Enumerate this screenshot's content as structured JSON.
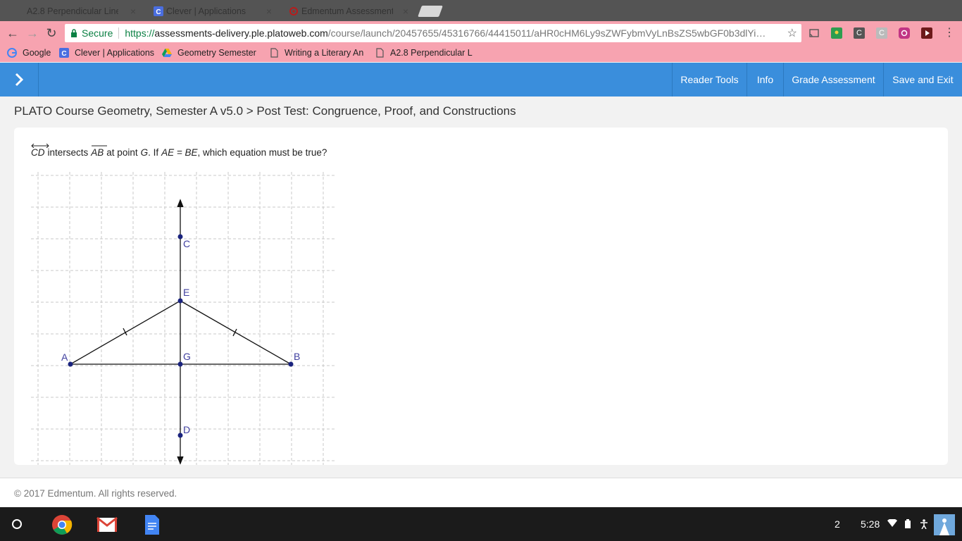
{
  "browser": {
    "tabs": [
      {
        "title": "A2.8 Perpendicular Line",
        "icon": "document-icon",
        "active": false
      },
      {
        "title": "Clever | Applications",
        "icon": "clever-icon",
        "active": false
      },
      {
        "title": "Edmentum Assessment",
        "icon": "edmentum-icon",
        "active": true
      }
    ],
    "close_glyph": "×",
    "security_label": "Secure",
    "url": {
      "scheme": "https://",
      "domain": "assessments-delivery.ple.platoweb.com",
      "path": "/course/launch/20457655/45316766/44415011/aHR0cHM6Ly9sZWFybmVyLnBsZS5wbGF0b3dlYi…"
    },
    "bookmarks": [
      {
        "label": "Google",
        "icon": "google-icon"
      },
      {
        "label": "Clever | Applications",
        "icon": "clever-icon"
      },
      {
        "label": "Geometry Semester",
        "icon": "drive-icon"
      },
      {
        "label": "Writing a Literary An",
        "icon": "document-icon"
      },
      {
        "label": "A2.8 Perpendicular L",
        "icon": "document-icon"
      }
    ],
    "extension_letters": [
      "C",
      "C"
    ]
  },
  "header": {
    "nav": [
      "Reader Tools",
      "Info",
      "Grade Assessment",
      "Save and Exit"
    ]
  },
  "breadcrumb": "PLATO Course Geometry, Semester A v5.0 > Post Test: Congruence, Proof, and Constructions",
  "question": {
    "line_name": "CD",
    "segment_name": "AB",
    "text_1": "intersects",
    "text_2": "at point",
    "point": "G",
    "text_3": ". If",
    "condition": "AE = BE",
    "text_4": ", which equation must be true?"
  },
  "figure": {
    "points": [
      "C",
      "E",
      "A",
      "G",
      "B",
      "D"
    ]
  },
  "footer": {
    "copyright": "© 2017 Edmentum. All rights reserved."
  },
  "shelf": {
    "apps": [
      "chrome-icon",
      "gmail-icon",
      "docs-icon"
    ],
    "notification_count": "2",
    "time": "5:28"
  },
  "colors": {
    "tab_strip": "#545454",
    "chrome_pink": "#f7a3b0",
    "header_blue": "#3a8edc",
    "point_navy": "#1a237e"
  }
}
